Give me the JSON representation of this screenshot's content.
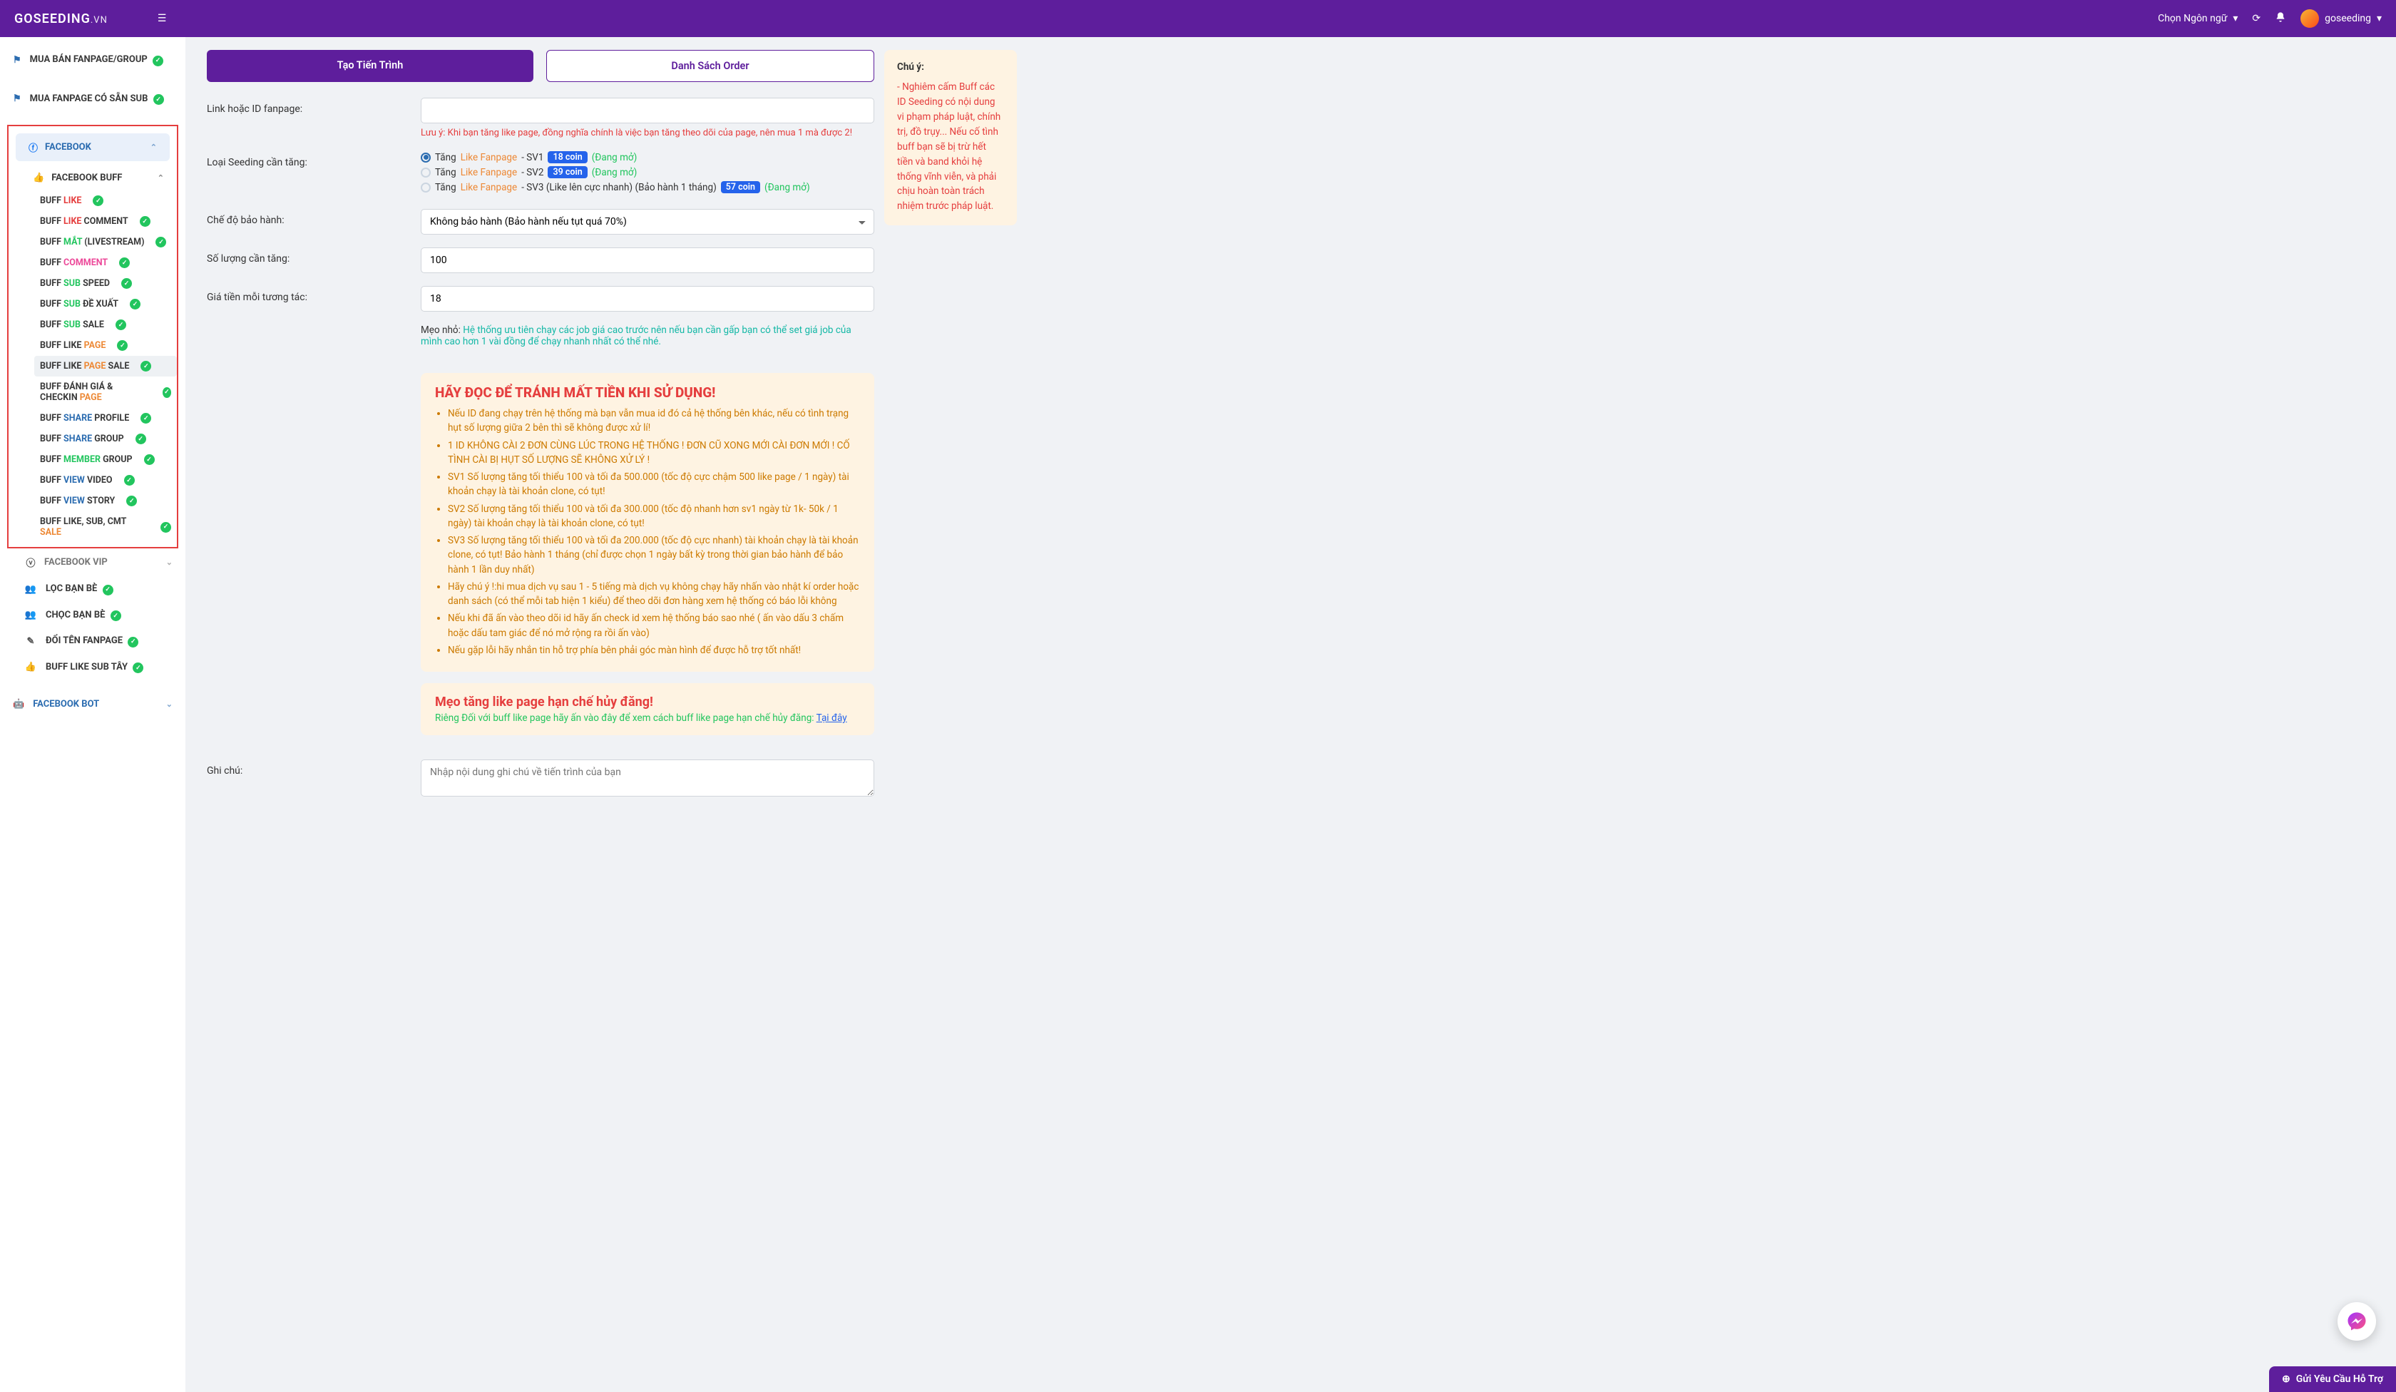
{
  "header": {
    "brand": "GOSEEDING",
    "tld": ".VN",
    "lang_label": "Chọn Ngôn ngữ",
    "username": "goseeding"
  },
  "sidebar": {
    "top1": "MUA BÁN FANPAGE/GROUP",
    "top2": "MUA FANPAGE CÓ SẴN SUB",
    "facebook": "FACEBOOK",
    "facebook_buff": "FACEBOOK BUFF",
    "items": [
      {
        "pre": "BUFF ",
        "hl": "LIKE",
        "hlc": "txt-red",
        "post": ""
      },
      {
        "pre": "BUFF ",
        "hl": "LIKE",
        "hlc": "txt-red",
        "post": " COMMENT"
      },
      {
        "pre": "BUFF ",
        "hl": "MẮT",
        "hlc": "txt-green",
        "post": " (LIVESTREAM)"
      },
      {
        "pre": "BUFF ",
        "hl": "COMMENT",
        "hlc": "txt-pink",
        "post": ""
      },
      {
        "pre": "BUFF ",
        "hl": "SUB",
        "hlc": "txt-green",
        "post": " SPEED"
      },
      {
        "pre": "BUFF ",
        "hl": "SUB",
        "hlc": "txt-green",
        "post": " ĐỀ XUẤT"
      },
      {
        "pre": "BUFF ",
        "hl": "SUB",
        "hlc": "txt-green",
        "post": " SALE"
      },
      {
        "pre": "BUFF LIKE ",
        "hl": "PAGE",
        "hlc": "txt-orange",
        "post": ""
      },
      {
        "pre": "BUFF LIKE ",
        "hl": "PAGE",
        "hlc": "txt-orange",
        "post": " SALE",
        "active": true
      },
      {
        "pre": "BUFF ĐÁNH GIÁ & CHECKIN ",
        "hl": "PAGE",
        "hlc": "txt-orange",
        "post": ""
      },
      {
        "pre": "BUFF ",
        "hl": "SHARE",
        "hlc": "txt-blue",
        "post": " PROFILE"
      },
      {
        "pre": "BUFF ",
        "hl": "SHARE",
        "hlc": "txt-blue",
        "post": " GROUP"
      },
      {
        "pre": "BUFF ",
        "hl": "MEMBER",
        "hlc": "txt-green",
        "post": " GROUP"
      },
      {
        "pre": "BUFF ",
        "hl": "VIEW",
        "hlc": "txt-blue",
        "post": " VIDEO"
      },
      {
        "pre": "BUFF ",
        "hl": "VIEW",
        "hlc": "txt-blue",
        "post": " STORY"
      },
      {
        "pre": "BUFF LIKE, SUB, CMT ",
        "hl": "SALE",
        "hlc": "txt-orange",
        "post": ""
      }
    ],
    "fb_vip": "FACEBOOK VIP",
    "loc_ban_be": "LỌC BẠN BÈ",
    "choc_ban_be": "CHỌC BẠN BÈ",
    "doi_ten": "ĐỔI TÊN FANPAGE",
    "buff_like_sub_tay": "BUFF LIKE SUB TÂY",
    "fb_bot": "FACEBOOK BOT"
  },
  "tabs": {
    "create": "Tạo Tiến Trình",
    "list": "Danh Sách Order"
  },
  "form": {
    "link_label": "Link hoặc ID fanpage:",
    "link_note": "Lưu ý: Khi bạn tăng like page, đồng nghĩa chính là việc bạn tăng theo dõi của page, nên mua 1 mà được 2!",
    "type_label": "Loại Seeding cần tăng:",
    "radio_tang": "Tăng ",
    "radio_like_fanpage": "Like Fanpage",
    "sv1": " - SV1 ",
    "sv2": " - SV2 ",
    "sv3": " - SV3 (Like lên cực nhanh) (Bảo hành 1 tháng) ",
    "coin1": "18 coin",
    "coin2": "39 coin",
    "coin3": "57 coin",
    "open": "(Đang mở)",
    "warranty_label": "Chế độ bảo hành:",
    "warranty_value": "Không bảo hành (Bảo hành nếu tụt quá 70%)",
    "qty_label": "Số lượng cần tăng:",
    "qty_value": "100",
    "price_label": "Giá tiền mỗi tương tác:",
    "price_value": "18",
    "tip_pre": "Mẹo nhỏ: ",
    "tip_body": "Hệ thống ưu tiên chạy các job giá cao trước nên nếu bạn cần gấp bạn có thể set giá job của mình cao hơn 1 vài đồng để chạy nhanh nhất có thể nhé.",
    "note_label": "Ghi chú:",
    "note_placeholder": "Nhập nội dung ghi chú về tiến trình của bạn"
  },
  "warn": {
    "title": "HÃY ĐỌC ĐỂ TRÁNH MẤT TIỀN KHI SỬ DỤNG!",
    "li1": "Nếu ID đang chạy trên hệ thống mà bạn vẫn mua id đó cả hệ thống bên khác, nếu có tình trạng hụt số lượng giữa 2 bên thì sẽ không được xử lí!",
    "li2": "1 ID KHÔNG CÀI 2 ĐƠN CÙNG LÚC TRONG HỆ THỐNG ! ĐƠN CŨ XONG MỚI CÀI ĐƠN MỚI ! CỐ TÌNH CÀI BỊ HỤT SỐ LƯỢNG SẼ KHÔNG XỬ LÝ !",
    "li3": "SV1 Số lượng tăng tối thiểu 100 và tối đa 500.000 (tốc độ cực chậm 500 like page / 1 ngày) tài khoản chạy là tài khoản clone, có tụt!",
    "li4": "SV2 Số lượng tăng tối thiểu 100 và tối đa 300.000 (tốc độ nhanh hơn sv1 ngày từ 1k- 50k / 1 ngày) tài khoản chạy là tài khoản clone, có tụt!",
    "li5": "SV3 Số lượng tăng tối thiểu 100 và tối đa 200.000 (tốc độ cực nhanh) tài khoản chạy là tài khoản clone, có tụt! Bảo hành 1 tháng (chỉ được chọn 1 ngày bất kỳ trong thời gian bảo hành để bảo hành 1 lần duy nhất)",
    "li6": "Hãy chú ý !:hi mua dịch vụ sau 1 - 5 tiếng mà dịch vụ không chạy hãy nhấn vào nhật kí order hoặc danh sách (có thể mỗi tab hiện 1 kiểu) để theo dõi đơn hàng xem hệ thống có báo lỗi không",
    "li7": "Nếu khi đã ấn vào theo dõi id hãy ấn check id xem hệ thống báo sao nhé ( ấn vào dấu 3 chấm hoặc dấu tam giác để nó mở rộng ra rồi ấn vào)",
    "li8": "Nếu gặp lỗi hãy nhắn tin hỗ trợ phía bên phải góc màn hình để được hỗ trợ tốt nhất!"
  },
  "tip_box": {
    "title": "Mẹo tăng like page hạn chế hủy đăng!",
    "sub_pre": "Riêng Đối với buff like page hãy ấn vào đây để xem cách buff like page hạn chế hủy đăng: ",
    "sub_link": "Tại đây"
  },
  "right": {
    "title": "Chú ý:",
    "body": "- Nghiêm cấm Buff các ID Seeding có nội dung vi phạm pháp luật, chính trị, đồ trụy... Nếu cố tình buff bạn sẽ bị trừ hết tiền và band khỏi hệ thống vĩnh viễn, và phải chịu hoàn toàn trách nhiệm trước pháp luật."
  },
  "support_btn": "Gửi Yêu Cầu Hỗ Trợ"
}
